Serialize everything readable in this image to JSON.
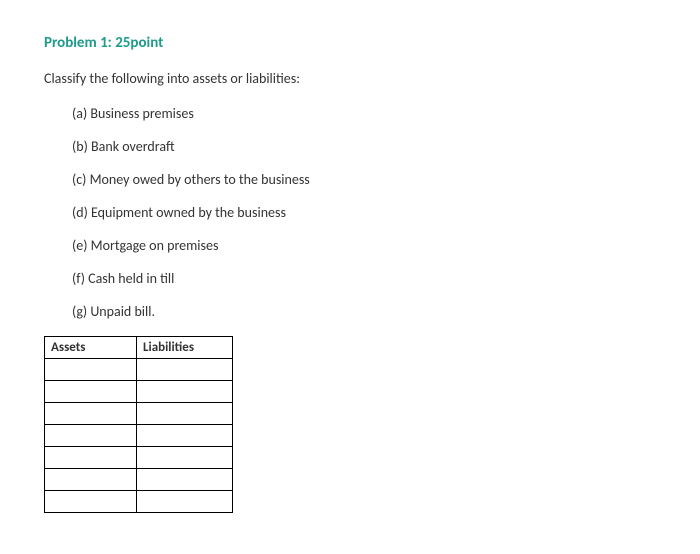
{
  "title": "Problem 1: 25point",
  "instruction": "Classify the following into assets or liabilities:",
  "items": [
    {
      "label": "(a) Business premises"
    },
    {
      "label": "(b) Bank overdraft"
    },
    {
      "label": "(c) Money owed by others to the business"
    },
    {
      "label": "(d) Equipment owned by the business"
    },
    {
      "label": "(e) Mortgage on premises"
    },
    {
      "label": "(f) Cash held in till"
    },
    {
      "label": "(g) Unpaid bill."
    }
  ],
  "table": {
    "headers": {
      "assets": "Assets",
      "liabilities": "Liabilities"
    },
    "rows": [
      {
        "assets": "",
        "liabilities": ""
      },
      {
        "assets": "",
        "liabilities": ""
      },
      {
        "assets": "",
        "liabilities": ""
      },
      {
        "assets": "",
        "liabilities": ""
      },
      {
        "assets": "",
        "liabilities": ""
      },
      {
        "assets": "",
        "liabilities": ""
      },
      {
        "assets": "",
        "liabilities": ""
      }
    ]
  }
}
